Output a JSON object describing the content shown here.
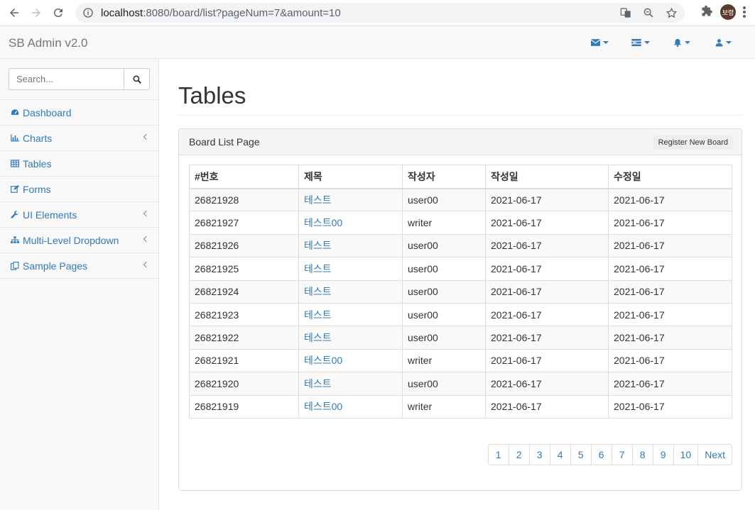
{
  "browser": {
    "url_host": "localhost",
    "url_rest": ":8080/board/list?pageNum=7&amount=10",
    "profile_initials": "보령"
  },
  "navbar": {
    "brand": "SB Admin v2.0"
  },
  "sidebar": {
    "search_placeholder": "Search...",
    "items": [
      {
        "label": "Dashboard",
        "icon": "dashboard-icon",
        "has_arrow": false
      },
      {
        "label": "Charts",
        "icon": "bar-chart-icon",
        "has_arrow": true
      },
      {
        "label": "Tables",
        "icon": "table-icon",
        "has_arrow": false
      },
      {
        "label": "Forms",
        "icon": "edit-icon",
        "has_arrow": false
      },
      {
        "label": "UI Elements",
        "icon": "wrench-icon",
        "has_arrow": true
      },
      {
        "label": "Multi-Level Dropdown",
        "icon": "sitemap-icon",
        "has_arrow": true
      },
      {
        "label": "Sample Pages",
        "icon": "files-icon",
        "has_arrow": true
      }
    ]
  },
  "main": {
    "page_title": "Tables",
    "panel_title": "Board List Page",
    "register_button": "Register New Board",
    "columns": [
      "#번호",
      "제목",
      "작성자",
      "작성일",
      "수정일"
    ],
    "rows": [
      [
        "26821928",
        "테스트",
        "user00",
        "2021-06-17",
        "2021-06-17"
      ],
      [
        "26821927",
        "테스트00",
        "writer",
        "2021-06-17",
        "2021-06-17"
      ],
      [
        "26821926",
        "테스트",
        "user00",
        "2021-06-17",
        "2021-06-17"
      ],
      [
        "26821925",
        "테스트",
        "user00",
        "2021-06-17",
        "2021-06-17"
      ],
      [
        "26821924",
        "테스트",
        "user00",
        "2021-06-17",
        "2021-06-17"
      ],
      [
        "26821923",
        "테스트",
        "user00",
        "2021-06-17",
        "2021-06-17"
      ],
      [
        "26821922",
        "테스트",
        "user00",
        "2021-06-17",
        "2021-06-17"
      ],
      [
        "26821921",
        "테스트00",
        "writer",
        "2021-06-17",
        "2021-06-17"
      ],
      [
        "26821920",
        "테스트",
        "user00",
        "2021-06-17",
        "2021-06-17"
      ],
      [
        "26821919",
        "테스트00",
        "writer",
        "2021-06-17",
        "2021-06-17"
      ]
    ],
    "pagination": [
      "1",
      "2",
      "3",
      "4",
      "5",
      "6",
      "7",
      "8",
      "9",
      "10",
      "Next"
    ]
  },
  "colors": {
    "link": "#337ab7",
    "sidebar_bg": "#f8f8f8"
  }
}
